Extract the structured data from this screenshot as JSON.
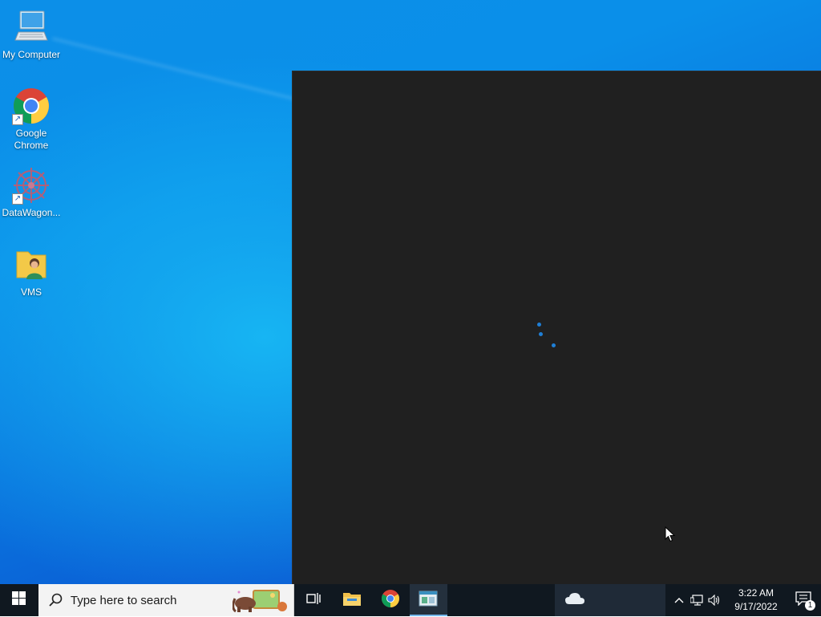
{
  "desktop": {
    "icons": [
      {
        "label": "My Computer",
        "icon": "computer-icon"
      },
      {
        "label": "Google Chrome",
        "icon": "chrome-icon"
      },
      {
        "label": "DataWagon...",
        "icon": "datawagon-icon"
      },
      {
        "label": "VMS",
        "icon": "folder-user-icon"
      }
    ]
  },
  "app_window": {
    "state": "loading",
    "accent_color": "#1f7fd6",
    "background_color": "#202020"
  },
  "taskbar": {
    "start_icon": "windows-logo-icon",
    "search": {
      "placeholder": "Type here to search"
    },
    "pinned": [
      {
        "name": "Task View",
        "icon": "task-view-icon"
      },
      {
        "name": "File Explorer",
        "icon": "folder-icon"
      },
      {
        "name": "Google Chrome",
        "icon": "chrome-icon"
      },
      {
        "name": "Active app",
        "icon": "app-window-icon",
        "active": true
      }
    ],
    "weather_icon": "cloud-icon",
    "tray": {
      "chevron": "chevron-up-icon",
      "network": "network-icon",
      "volume": "volume-icon"
    },
    "clock": {
      "time": "3:22 AM",
      "date": "9/17/2022"
    },
    "notifications": {
      "count": "1"
    }
  }
}
